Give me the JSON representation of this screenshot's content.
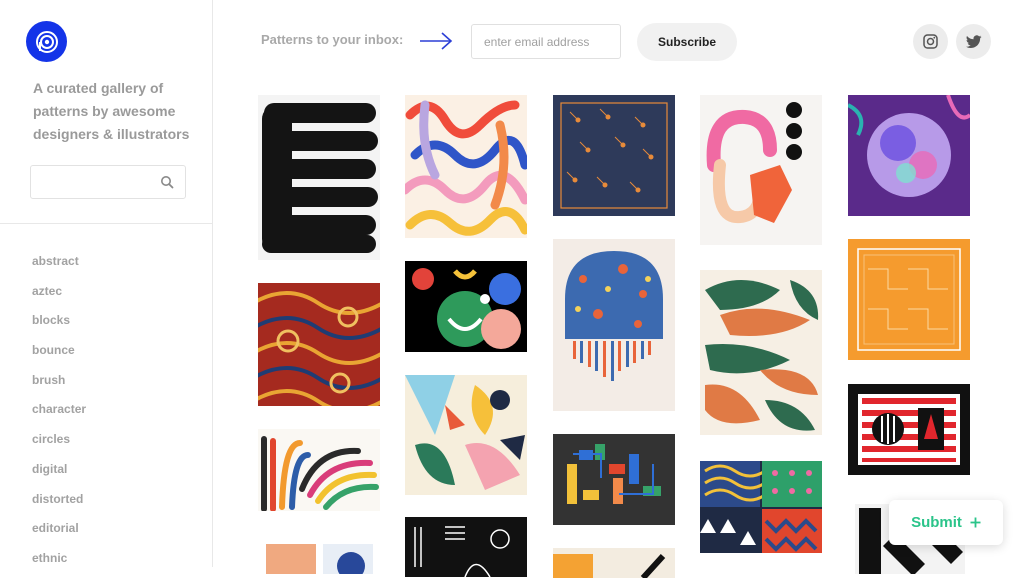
{
  "brand": {
    "logo_icon": "p-spiral-logo-icon",
    "accent": "#1434e8"
  },
  "sidebar": {
    "tagline": "A curated gallery of patterns by awesome designers & illustrators",
    "search": {
      "value": "",
      "placeholder": "",
      "icon": "search-icon"
    },
    "categories": [
      "abstract",
      "aztec",
      "blocks",
      "bounce",
      "brush",
      "character",
      "circles",
      "digital",
      "distorted",
      "editorial",
      "ethnic"
    ]
  },
  "header": {
    "newsletter_label": "Patterns to your inbox:",
    "arrow_icon": "arrow-right-icon",
    "email_placeholder": "enter email address",
    "subscribe_label": "Subscribe",
    "social": [
      "instagram-icon",
      "twitter-icon"
    ]
  },
  "gallery": {
    "tiles": [
      "black-brush-waves",
      "colorful-squiggles",
      "navy-orange-comets",
      "pink-arch-black-dots",
      "purple-cosmic-circle",
      "red-tribal-pattern",
      "green-smile-circles",
      "orange-geometric-bandana",
      "rainbow-arches",
      "tropical-collage",
      "splatter-arch",
      "green-orange-leaves",
      "striped-stamp",
      "black-line-art",
      "color-blocks-on-black",
      "triangles-and-waves",
      "black-white-brush"
    ]
  },
  "submit": {
    "label": "Submit",
    "icon": "plus-icon",
    "color": "#2bc48a"
  }
}
